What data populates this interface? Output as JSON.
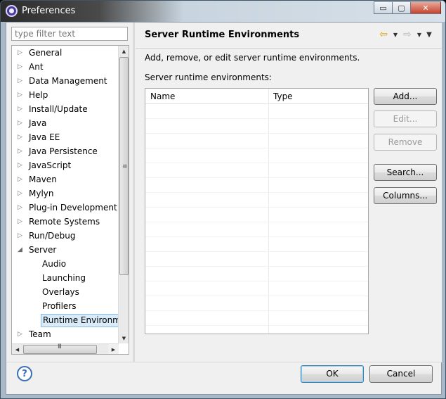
{
  "window": {
    "title": "Preferences"
  },
  "window_controls": {
    "minimize": "▭",
    "maximize": "▢",
    "close": "✕"
  },
  "filter": {
    "placeholder": "type filter text"
  },
  "tree": {
    "items": [
      {
        "label": "General",
        "expanded": false
      },
      {
        "label": "Ant",
        "expanded": false
      },
      {
        "label": "Data Management",
        "expanded": false
      },
      {
        "label": "Help",
        "expanded": false
      },
      {
        "label": "Install/Update",
        "expanded": false
      },
      {
        "label": "Java",
        "expanded": false
      },
      {
        "label": "Java EE",
        "expanded": false
      },
      {
        "label": "Java Persistence",
        "expanded": false
      },
      {
        "label": "JavaScript",
        "expanded": false
      },
      {
        "label": "Maven",
        "expanded": false
      },
      {
        "label": "Mylyn",
        "expanded": false
      },
      {
        "label": "Plug-in Development",
        "expanded": false
      },
      {
        "label": "Remote Systems",
        "expanded": false
      },
      {
        "label": "Run/Debug",
        "expanded": false
      },
      {
        "label": "Server",
        "expanded": true
      },
      {
        "label": "Audio",
        "child": true
      },
      {
        "label": "Launching",
        "child": true
      },
      {
        "label": "Overlays",
        "child": true
      },
      {
        "label": "Profilers",
        "child": true
      },
      {
        "label": "Runtime Environments",
        "child": true,
        "selected": true
      },
      {
        "label": "Team",
        "expanded": false
      }
    ],
    "collapsed_arrow": "▷",
    "expanded_arrow": "◢",
    "scroll_grip_v": "≡",
    "scroll_grip_h": "III"
  },
  "page": {
    "title": "Server Runtime Environments",
    "description": "Add, remove, or edit server runtime environments.",
    "list_label": "Server runtime environments:",
    "columns": [
      "Name",
      "Type"
    ],
    "nav_back_icon": "⇦",
    "nav_forward_icon": "⇨",
    "menu_icon": "▼"
  },
  "buttons": {
    "add": "Add...",
    "edit": "Edit...",
    "remove": "Remove",
    "search": "Search...",
    "columns": "Columns..."
  },
  "footer": {
    "help_icon": "?",
    "ok": "OK",
    "cancel": "Cancel"
  }
}
